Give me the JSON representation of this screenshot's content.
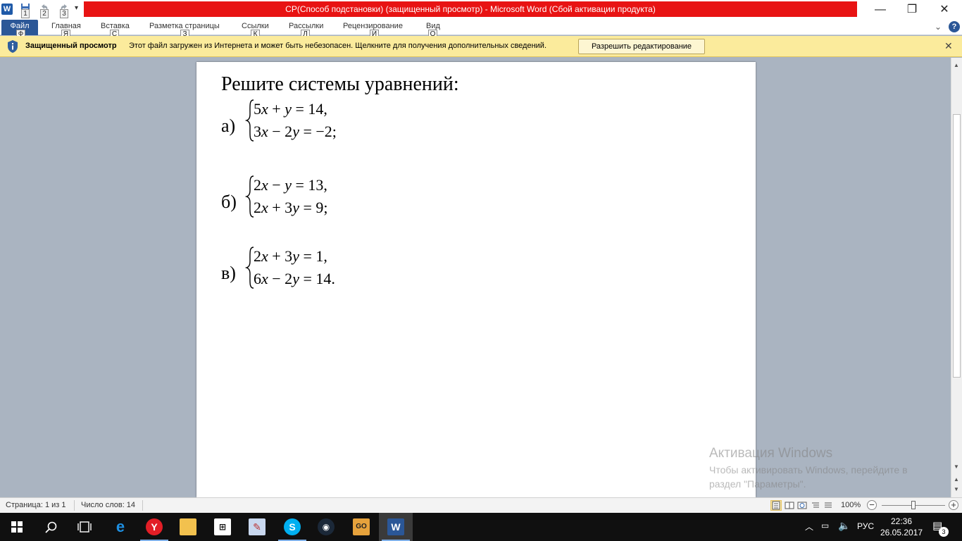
{
  "titlebar": {
    "title": "СР(Способ подстановки) (защищенный просмотр)  -  Microsoft Word (Сбой активации продукта)",
    "qat_keytips": [
      "1",
      "2",
      "3"
    ],
    "app_icon_letter": "W"
  },
  "ribbon": {
    "tabs": [
      {
        "label": "Файл",
        "keytip": "Ф"
      },
      {
        "label": "Главная",
        "keytip": "Я"
      },
      {
        "label": "Вставка",
        "keytip": "С"
      },
      {
        "label": "Разметка страницы",
        "keytip": "З"
      },
      {
        "label": "Ссылки",
        "keytip": "К"
      },
      {
        "label": "Рассылки",
        "keytip": "Л"
      },
      {
        "label": "Рецензирование",
        "keytip": "И"
      },
      {
        "label": "Вид",
        "keytip": "О"
      }
    ]
  },
  "protected_view": {
    "title": "Защищенный просмотр",
    "message": "Этот файл загружен из Интернета и может быть небезопасен. Щелкните для получения дополнительных сведений.",
    "enable_button": "Разрешить редактирование"
  },
  "document": {
    "heading": "Решите системы уравнений:",
    "problems": [
      {
        "label": "а)",
        "eq1": [
          "5",
          "x",
          " + ",
          "y",
          " = 14,"
        ],
        "eq2": [
          "3",
          "x",
          " − 2",
          "y",
          " = −2;"
        ]
      },
      {
        "label": "б)",
        "eq1": [
          "2",
          "x",
          " − ",
          "y",
          " = 13,"
        ],
        "eq2": [
          "2",
          "x",
          " + 3",
          "y",
          " = 9;"
        ]
      },
      {
        "label": "в)",
        "eq1": [
          "2",
          "x",
          " + 3",
          "y",
          " = 1,"
        ],
        "eq2": [
          "6",
          "x",
          " − 2",
          "y",
          " = 14."
        ]
      }
    ]
  },
  "watermark": {
    "line1": "Активация Windows",
    "line2": "Чтобы активировать Windows, перейдите в раздел \"Параметры\"."
  },
  "statusbar": {
    "page": "Страница: 1 из 1",
    "words": "Число слов: 14",
    "zoom": "100%",
    "zoom_level_percent": 100
  },
  "taskbar": {
    "language": "РУС",
    "time": "22:36",
    "date": "26.05.2017",
    "notification_count": "3",
    "apps": [
      "start",
      "search",
      "task-view",
      "edge",
      "yandex-browser",
      "file-explorer",
      "store",
      "paint",
      "skype",
      "steam",
      "csgo",
      "word"
    ]
  }
}
